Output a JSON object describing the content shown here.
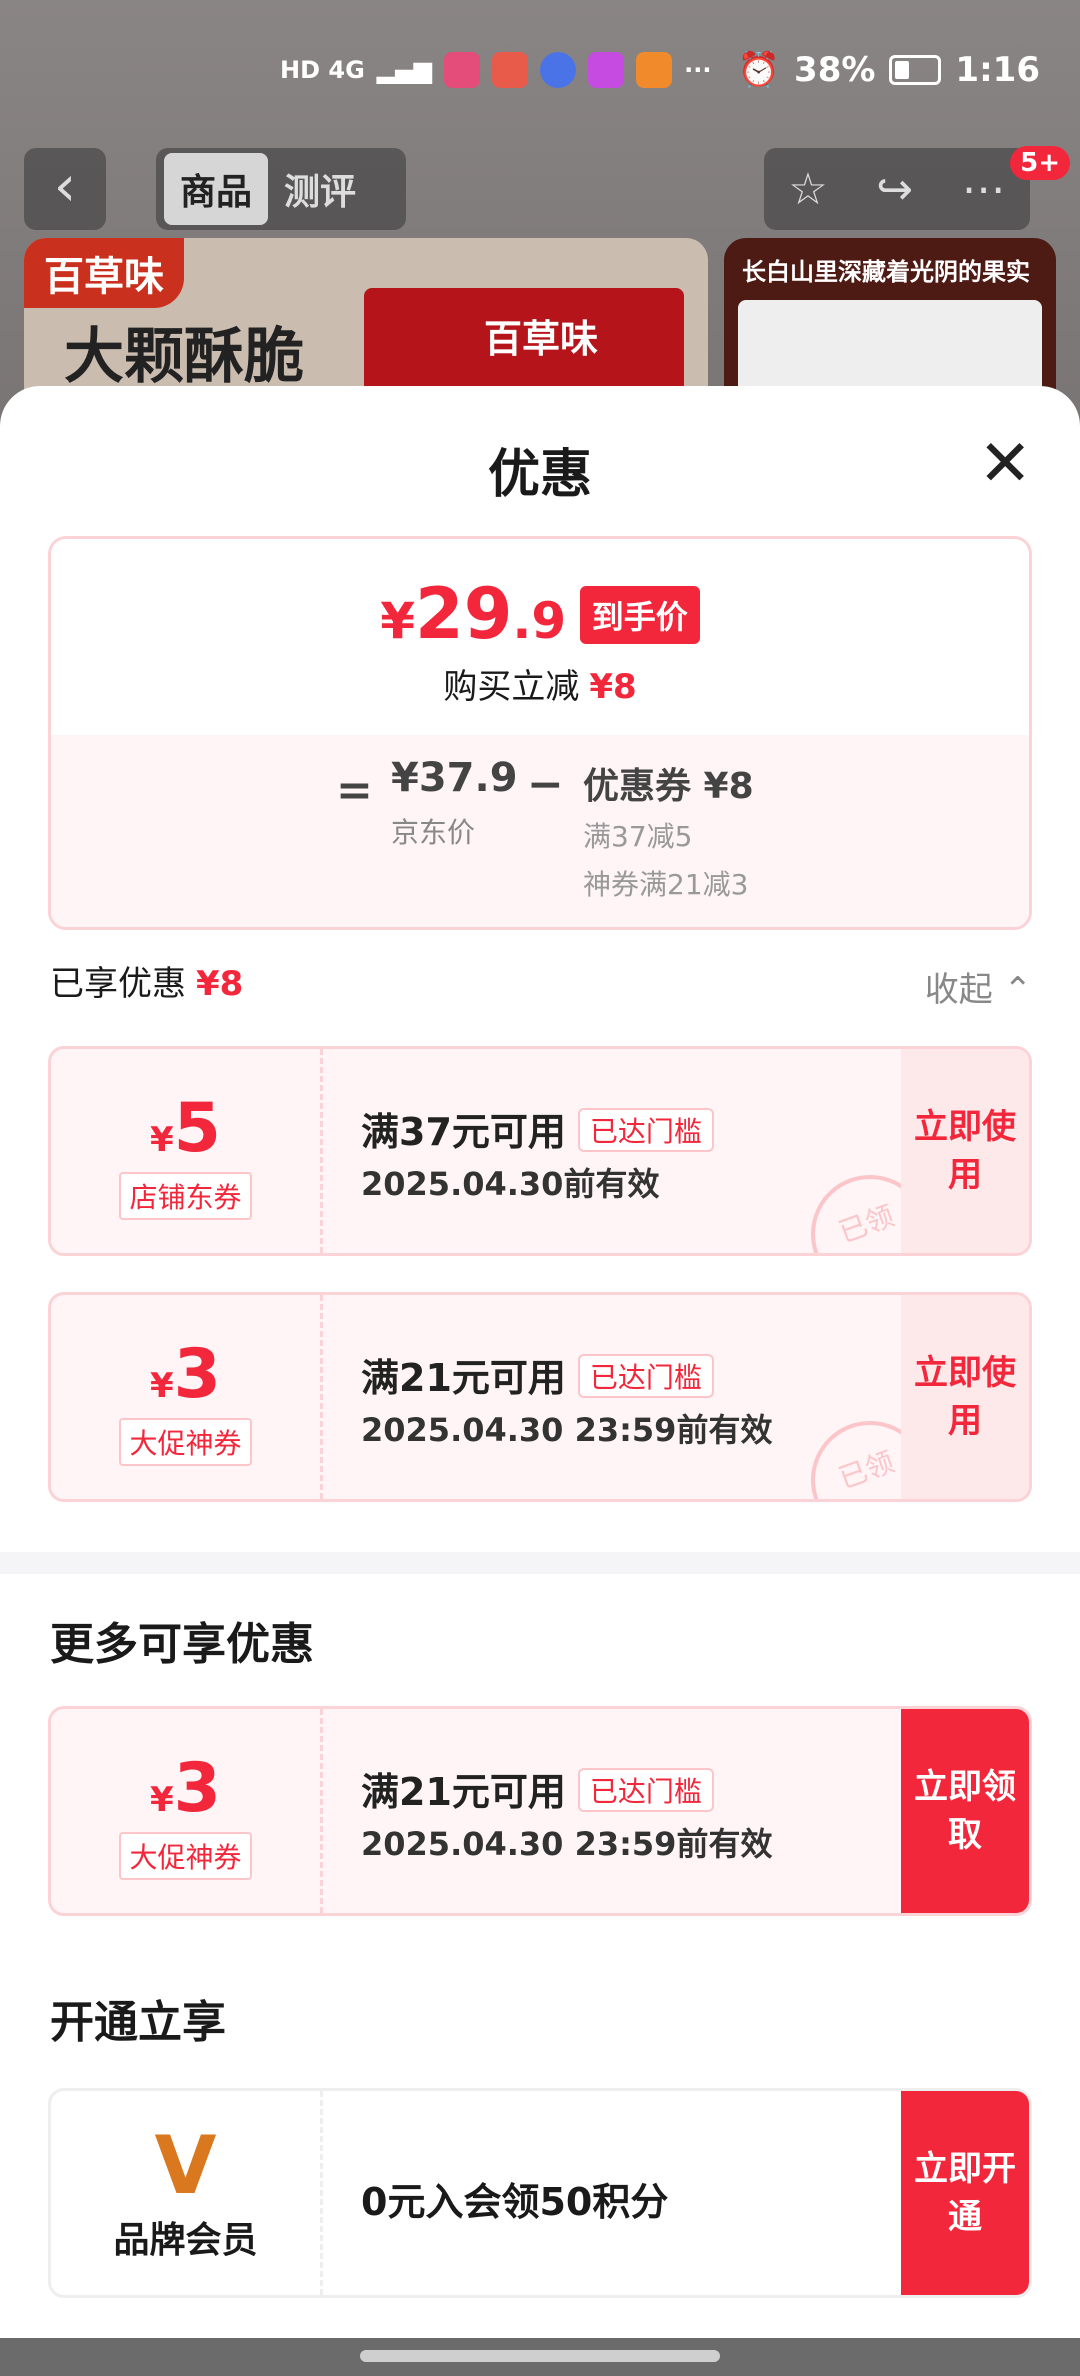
{
  "status": {
    "network": "HD 4G",
    "battery": "38%",
    "time": "1:16"
  },
  "nav": {
    "back": "‹",
    "tab_goods": "商品",
    "tab_review": "测评",
    "badge": "5+"
  },
  "banner": {
    "brand": "百草味",
    "slogan": "大颗酥脆",
    "pack_brand": "百草味",
    "right_caption": "长白山里深藏着光阴的果实"
  },
  "sheet": {
    "title": "优惠",
    "close": "✕",
    "summary": {
      "yen": "¥",
      "price_int": "29",
      "price_dec": ".9",
      "price_tag": "到手价",
      "save_label": "购买立减",
      "save_amount": "¥8",
      "eq": "=",
      "jd_price": "¥37.9",
      "jd_label": "京东价",
      "minus": "−",
      "coupon_total": "优惠券 ¥8",
      "coupon_detail_1": "满37减5",
      "coupon_detail_2": "神券满21减3"
    },
    "enjoyed": {
      "label": "已享优惠",
      "amount": "¥8",
      "collapse": "收起 ⌃"
    },
    "coupons": [
      {
        "yen": "¥",
        "amount": "5",
        "type": "店铺东券",
        "condition": "满37元可用",
        "threshold": "已达门槛",
        "validity": "2025.04.30前有效",
        "button": "立即使用",
        "stamp": "已领"
      },
      {
        "yen": "¥",
        "amount": "3",
        "type": "大促神券",
        "condition": "满21元可用",
        "threshold": "已达门槛",
        "validity": "2025.04.30 23:59前有效",
        "button": "立即使用",
        "stamp": "已领"
      }
    ],
    "more": {
      "title": "更多可享优惠",
      "coupon": {
        "yen": "¥",
        "amount": "3",
        "type": "大促神券",
        "condition": "满21元可用",
        "threshold": "已达门槛",
        "validity": "2025.04.30 23:59前有效",
        "button": "立即领取"
      }
    },
    "open": {
      "title": "开通立享",
      "logo": "V",
      "label": "品牌会员",
      "text": "0元入会领50积分",
      "button": "立即开通"
    }
  }
}
